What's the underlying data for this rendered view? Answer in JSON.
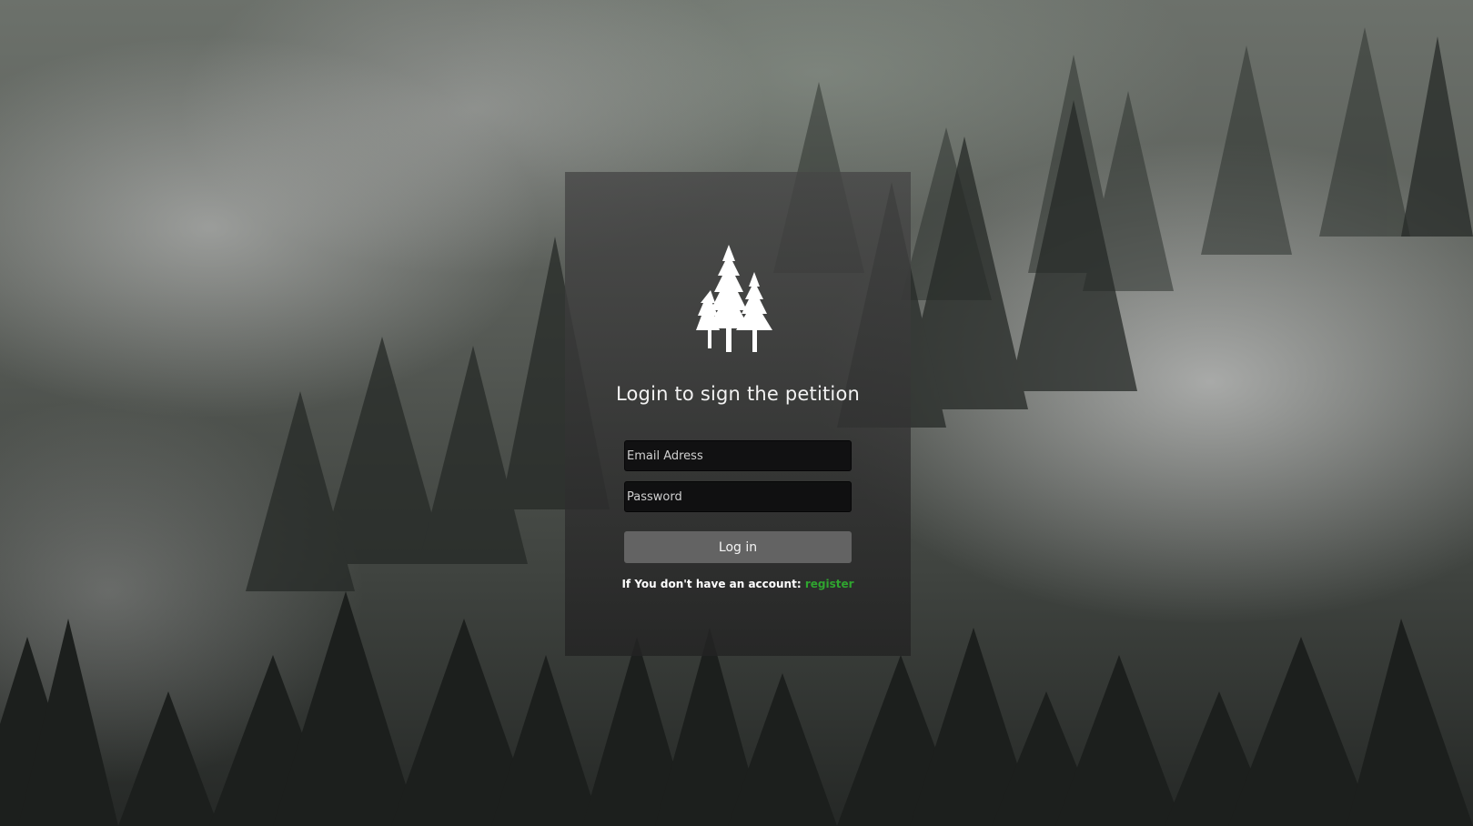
{
  "login": {
    "title": "Login to sign the petition",
    "email_placeholder": "Email Adress",
    "password_placeholder": "Password",
    "login_button": "Log in",
    "register_prompt": "If You don't have an account: ",
    "register_link": "register"
  },
  "icons": {
    "logo": "pine-tree-icon"
  },
  "colors": {
    "link": "#2fa52f",
    "panel": "#2a2a2a",
    "text": "#ffffff"
  }
}
